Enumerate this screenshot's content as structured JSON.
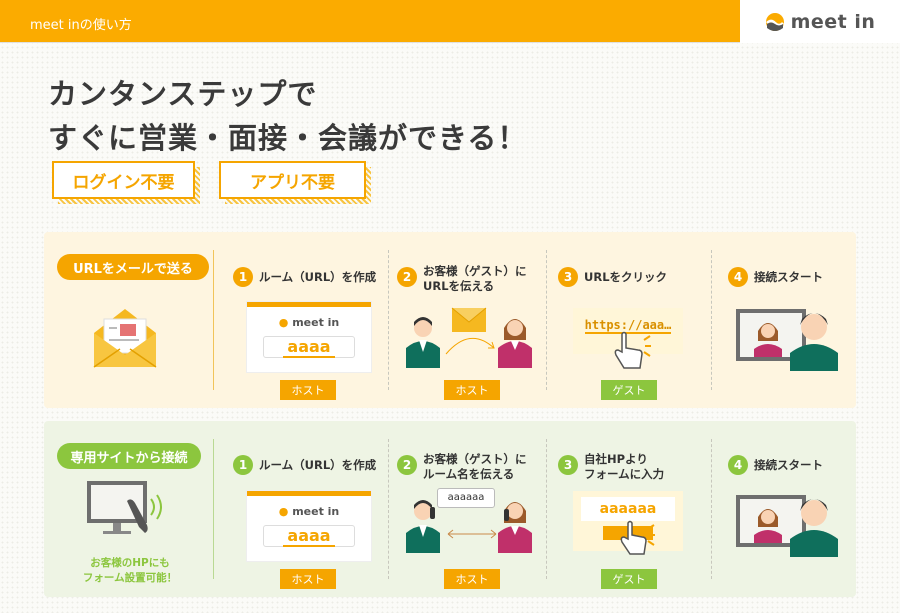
{
  "header": {
    "title": "meet inの使い方",
    "logo": "meet in"
  },
  "headline": {
    "line1": "カンタンステップで",
    "line2": "すぐに営業・面接・会議ができる！"
  },
  "tags": [
    "ログイン不要",
    "アプリ不要"
  ],
  "rows": [
    {
      "pill": "URLをメールで送る",
      "steps": [
        {
          "num": "1",
          "label_1": "ルーム（URL）を作成",
          "label_2": "",
          "role": "ホスト",
          "room_logo": "meet in",
          "room_value": "aaaa"
        },
        {
          "num": "2",
          "label_1": "お客様（ゲスト）に",
          "label_2": "URLを伝える",
          "role": "ホスト"
        },
        {
          "num": "3",
          "label_1": "URLをクリック",
          "label_2": "",
          "role": "ゲスト",
          "url": "https://aaa…"
        },
        {
          "num": "4",
          "label_1": "接続スタート",
          "label_2": ""
        }
      ]
    },
    {
      "pill": "専用サイトから接続",
      "note_1": "お客様のHPにも",
      "note_2": "フォーム設置可能！",
      "steps": [
        {
          "num": "1",
          "label_1": "ルーム（URL）を作成",
          "label_2": "",
          "role": "ホスト",
          "room_logo": "meet in",
          "room_value": "aaaa"
        },
        {
          "num": "2",
          "label_1": "お客様（ゲスト）に",
          "label_2": "ルーム名を伝える",
          "role": "ホスト",
          "speech": "aaaaaa"
        },
        {
          "num": "3",
          "label_1": "自社HPより",
          "label_2": "フォームに入力",
          "role": "ゲスト",
          "form_value": "aaaaaa"
        },
        {
          "num": "4",
          "label_1": "接続スタート",
          "label_2": ""
        }
      ]
    }
  ],
  "colors": {
    "orange": "#f5a500",
    "green": "#8cc63e",
    "header": "#fbab00",
    "suit": "#0f6f5c",
    "guest": "#c0306a"
  },
  "icons": [
    "envelope-icon",
    "meet-in-logo-icon",
    "host-person-icon",
    "guest-person-icon",
    "mail-icon",
    "pointer-hand-icon",
    "monitor-phone-icon",
    "video-call-icon",
    "arrow-icon"
  ]
}
